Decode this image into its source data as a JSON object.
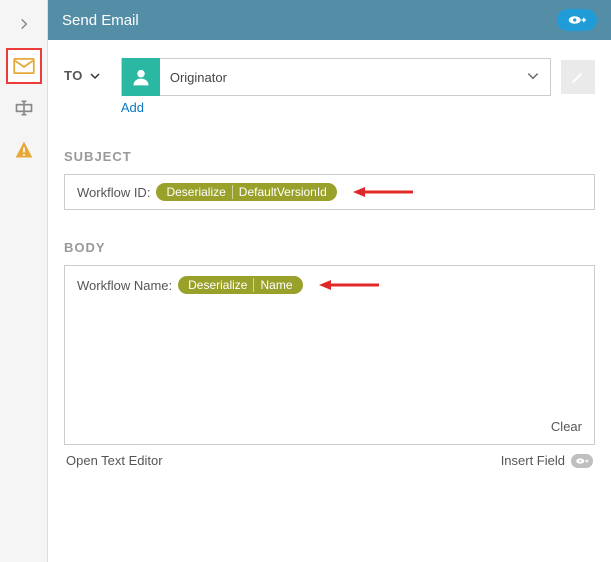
{
  "header": {
    "title": "Send Email"
  },
  "sidebar": {
    "items": [
      {
        "name": "collapse-icon"
      },
      {
        "name": "email-icon"
      },
      {
        "name": "form-icon"
      },
      {
        "name": "alert-icon"
      }
    ]
  },
  "to": {
    "label": "TO",
    "value": "Originator",
    "add_link": "Add"
  },
  "subject": {
    "label": "SUBJECT",
    "prefix": "Workflow ID:",
    "token_parts": [
      "Deserialize",
      "DefaultVersionId"
    ]
  },
  "body": {
    "label": "BODY",
    "prefix": "Workflow Name:",
    "token_parts": [
      "Deserialize",
      "Name"
    ],
    "clear_label": "Clear"
  },
  "footer": {
    "open_editor": "Open Text Editor",
    "insert_field": "Insert Field"
  }
}
